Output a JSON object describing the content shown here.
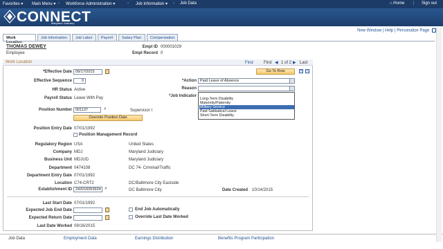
{
  "topnav": {
    "favorites": "Favorites",
    "main_menu": "Main Menu",
    "workforce": "Workforce Administration",
    "job_information": "Job Information",
    "job_data": "Job Data",
    "home": "Home",
    "sign_out": "Sign out"
  },
  "brand": {
    "name": "CONNECT",
    "sub": "Maryland Judiciary"
  },
  "toplinks": {
    "new_window": "New Window",
    "help": "Help",
    "personalize": "Personalize Page"
  },
  "tabs": [
    "Work Location",
    "Job Information",
    "Job Labor",
    "Payroll",
    "Salary Plan",
    "Compensation"
  ],
  "employee": {
    "name": "THOMAS DEWEY",
    "role": "Employee",
    "empl_id_label": "Empl ID",
    "empl_id": "000001029",
    "empl_record_label": "Empl Record",
    "empl_record": "0"
  },
  "frame": {
    "title": "Work Location",
    "find": "Find",
    "first": "First",
    "count": "1 of 2",
    "last": "Last"
  },
  "fields": {
    "effective_date_label": "*Effective Date",
    "effective_date": "09/17/2015",
    "effective_seq_label": "Effective Sequence",
    "effective_seq": "0",
    "hr_status_label": "HR Status",
    "hr_status": "Active",
    "payroll_status_label": "Payroll Status",
    "payroll_status": "Leave With Pay",
    "action_label": "*Action",
    "action": "Paid Leave of Absence",
    "reason_label": "Reason",
    "reason": "",
    "job_indicator_label": "*Job Indicator",
    "go_to_row": "Go To Row",
    "position_number_label": "Position Number",
    "position_number": "001137",
    "position_title": "Supervisor I",
    "override_position_date": "Override Position Date",
    "position_entry_date_label": "Position Entry Date",
    "position_entry_date": "07/01/1992",
    "position_mgmt_record": "Position Management Record",
    "regulatory_region_label": "Regulatory Region",
    "regulatory_region": "USA",
    "regulatory_region_desc": "United States",
    "company_label": "Company",
    "company": "MDJ",
    "company_desc": "Maryland Judiciary",
    "business_unit_label": "Business Unit",
    "business_unit": "MDJUD",
    "business_unit_desc": "Maryland Judiciary",
    "department_label": "Department",
    "department": "0474108",
    "department_desc": "DC 74- Criminal/Traffic",
    "dept_entry_date_label": "Department Entry Date",
    "dept_entry_date": "07/01/1992",
    "location_label": "Location",
    "location": "C74-CRT2",
    "location_desc": "DC/Baltimore City Eastside",
    "establishment_id_label": "Establishment ID",
    "establishment_id": "242016053924",
    "establishment_desc": "DC Baltimore City",
    "date_created_label": "Date Created",
    "date_created": "10/14/2015",
    "last_start_date_label": "Last Start Date",
    "last_start_date": "07/01/1992",
    "expected_job_end_label": "Expected Job End Date",
    "end_job_auto": "End Job Automatically",
    "expected_return_label": "Expected Return Date",
    "override_last_date": "Override Last Date Worked",
    "last_date_worked_label": "Last Date Worked",
    "last_date_worked": "09/16/2015"
  },
  "reason_options": [
    "",
    "Long-Term Disability",
    "Maternity/Paternity",
    "Military Service",
    "Paid Sabbatical Leave",
    "Short-Term Disability"
  ],
  "bottom_links": [
    "Job Data",
    "Employment Data",
    "Earnings Distribution",
    "Benefits Program Participation"
  ],
  "colors": {
    "nav_bg": "#1d3b67",
    "link": "#1d4f91",
    "selected": "#3b6db2"
  }
}
